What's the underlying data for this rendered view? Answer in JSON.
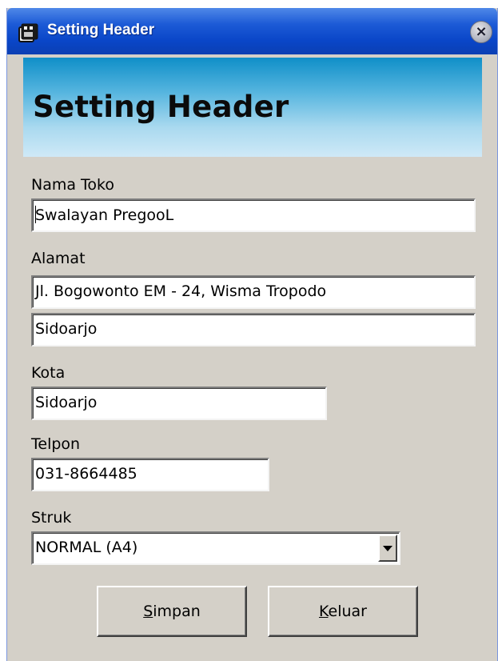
{
  "window": {
    "title": "Setting Header",
    "close_label": "×"
  },
  "banner": {
    "title": "Setting Header"
  },
  "form": {
    "nama_toko": {
      "label": "Nama Toko",
      "value": "Swalayan PregooL"
    },
    "alamat": {
      "label": "Alamat",
      "line1": "Jl. Bogowonto EM - 24, Wisma Tropodo",
      "line2": "Sidoarjo"
    },
    "kota": {
      "label": "Kota",
      "value": "Sidoarjo"
    },
    "telpon": {
      "label": "Telpon",
      "value": "031-8664485"
    },
    "struk": {
      "label": "Struk",
      "selected": "NORMAL (A4)"
    }
  },
  "buttons": {
    "simpan": {
      "mnemonic": "S",
      "rest": "impan"
    },
    "keluar": {
      "mnemonic": "K",
      "rest": "eluar"
    }
  },
  "colors": {
    "titlebar": "#0a46c8",
    "window_bg": "#d4d0c8",
    "banner_top": "#0f8fc8",
    "banner_bottom": "#cfe9f7"
  },
  "icons": {
    "app": "film-reel-icon",
    "close": "close-icon",
    "dropdown": "chevron-down-icon"
  }
}
